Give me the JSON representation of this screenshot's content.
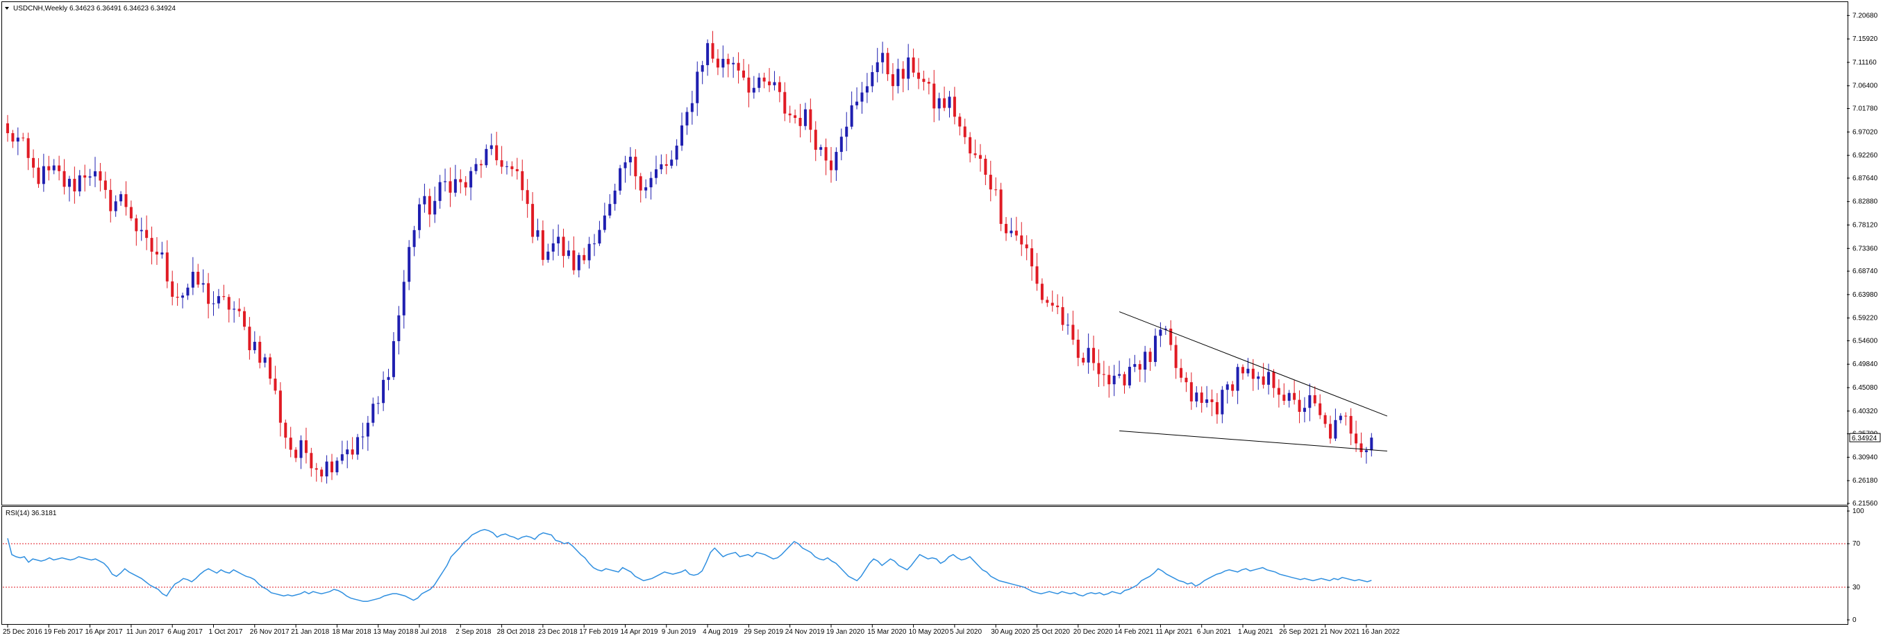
{
  "header": {
    "symbol": "USDCNH,Weekly",
    "ohlc": "6.34623 6.36491 6.34623 6.34924"
  },
  "rsi_label": "RSI(14) 36.3181",
  "current_price_label": "6.34924",
  "colors": {
    "bull": "#1f1fb0",
    "bear": "#e01b24",
    "rsi": "#2f8fe0",
    "rsi_level": "#e01b24",
    "trendline": "#000000",
    "axis": "#000000"
  },
  "chart_data": [
    {
      "type": "candlestick",
      "symbol": "USDCNH",
      "timeframe": "Weekly",
      "ylim": [
        6.2156,
        7.2242
      ],
      "y_ticks": [
        "7.20680",
        "7.15920",
        "7.11160",
        "7.06400",
        "7.01780",
        "6.97020",
        "6.92260",
        "6.87640",
        "6.82880",
        "6.78120",
        "6.73360",
        "6.68740",
        "6.63980",
        "6.59220",
        "6.54600",
        "6.49840",
        "6.45080",
        "6.40320",
        "6.35700",
        "6.30940",
        "6.26180",
        "6.21560"
      ],
      "x_ticks": [
        "25 Dec 2016",
        "19 Feb 2017",
        "16 Apr 2017",
        "11 Jun 2017",
        "6 Aug 2017",
        "1 Oct 2017",
        "26 Nov 2017",
        "21 Jan 2018",
        "18 Mar 2018",
        "13 May 2018",
        "8 Jul 2018",
        "2 Sep 2018",
        "28 Oct 2018",
        "23 Dec 2018",
        "17 Feb 2019",
        "14 Apr 2019",
        "9 Jun 2019",
        "4 Aug 2019",
        "29 Sep 2019",
        "24 Nov 2019",
        "19 Jan 2020",
        "15 Mar 2020",
        "10 May 2020",
        "5 Jul 2020",
        "30 Aug 2020",
        "25 Oct 2020",
        "20 Dec 2020",
        "14 Feb 2021",
        "11 Apr 2021",
        "6 Jun 2021",
        "1 Aug 2021",
        "26 Sep 2021",
        "21 Nov 2021",
        "16 Jan 2022"
      ],
      "path": [
        [
          "25 Dec 2016",
          6.96
        ],
        [
          "19 Feb 2017",
          6.87
        ],
        [
          "16 Apr 2017",
          6.88
        ],
        [
          "11 Jun 2017",
          6.8
        ],
        [
          "6 Aug 2017",
          6.66
        ],
        [
          "1 Oct 2017",
          6.64
        ],
        [
          "26 Nov 2017",
          6.55
        ],
        [
          "21 Jan 2018",
          6.31
        ],
        [
          "18 Mar 2018",
          6.3
        ],
        [
          "13 May 2018",
          6.4
        ],
        [
          "8 Jul 2018",
          6.82
        ],
        [
          "2 Sep 2018",
          6.87
        ],
        [
          "28 Oct 2018",
          6.93
        ],
        [
          "23 Dec 2018",
          6.74
        ],
        [
          "17 Feb 2019",
          6.71
        ],
        [
          "14 Apr 2019",
          6.89
        ],
        [
          "9 Jun 2019",
          6.88
        ],
        [
          "4 Aug 2019",
          7.14
        ],
        [
          "29 Sep 2019",
          7.08
        ],
        [
          "24 Nov 2019",
          7.02
        ],
        [
          "19 Jan 2020",
          6.92
        ],
        [
          "15 Mar 2020",
          7.1
        ],
        [
          "10 May 2020",
          7.09
        ],
        [
          "5 Jul 2020",
          7.0
        ],
        [
          "30 Aug 2020",
          6.84
        ],
        [
          "25 Oct 2020",
          6.67
        ],
        [
          "20 Dec 2020",
          6.52
        ],
        [
          "14 Feb 2021",
          6.46
        ],
        [
          "11 Apr 2021",
          6.55
        ],
        [
          "6 Jun 2021",
          6.4
        ],
        [
          "1 Aug 2021",
          6.48
        ],
        [
          "26 Sep 2021",
          6.44
        ],
        [
          "21 Nov 2021",
          6.38
        ],
        [
          "16 Jan 2022",
          6.35
        ]
      ],
      "last_close": 6.34924,
      "trendlines": [
        {
          "name": "upper",
          "from": [
            "14 Feb 2021",
            6.605
          ],
          "to": [
            "16 Jan 2022",
            6.393
          ]
        },
        {
          "name": "lower",
          "from": [
            "14 Feb 2021",
            6.363
          ],
          "to": [
            "16 Jan 2022",
            6.322
          ]
        }
      ]
    },
    {
      "type": "line",
      "name": "RSI(14)",
      "ylim": [
        0,
        100
      ],
      "y_ticks": [
        "100",
        "70",
        "30",
        "0"
      ],
      "levels": [
        70,
        30
      ],
      "last_value": 36.3181,
      "values": [
        75,
        60,
        58,
        57,
        58,
        53,
        56,
        55,
        54,
        55,
        57,
        55,
        56,
        57,
        56,
        55,
        56,
        58,
        57,
        56,
        55,
        56,
        54,
        52,
        48,
        42,
        40,
        43,
        47,
        44,
        42,
        40,
        38,
        35,
        32,
        30,
        28,
        24,
        22,
        28,
        33,
        35,
        38,
        37,
        35,
        38,
        42,
        45,
        47,
        45,
        43,
        46,
        44,
        43,
        46,
        44,
        42,
        40,
        39,
        37,
        33,
        30,
        28,
        25,
        24,
        23,
        22,
        23,
        22,
        23,
        24,
        26,
        24,
        26,
        25,
        24,
        25,
        26,
        28,
        27,
        25,
        22,
        20,
        19,
        18,
        17,
        17,
        18,
        19,
        20,
        22,
        23,
        24,
        24,
        23,
        22,
        20,
        18,
        20,
        24,
        26,
        28,
        32,
        38,
        44,
        50,
        58,
        62,
        66,
        71,
        74,
        78,
        80,
        82,
        83,
        82,
        80,
        76,
        78,
        79,
        77,
        76,
        74,
        76,
        77,
        76,
        74,
        78,
        80,
        79,
        78,
        73,
        72,
        70,
        71,
        68,
        64,
        60,
        57,
        52,
        48,
        46,
        45,
        47,
        46,
        45,
        44,
        48,
        46,
        44,
        40,
        38,
        36,
        37,
        38,
        40,
        42,
        44,
        43,
        42,
        43,
        44,
        46,
        42,
        41,
        42,
        45,
        53,
        62,
        66,
        62,
        58,
        60,
        61,
        62,
        58,
        59,
        60,
        58,
        62,
        61,
        60,
        58,
        56,
        57,
        60,
        64,
        68,
        72,
        70,
        66,
        64,
        62,
        58,
        56,
        55,
        57,
        54,
        52,
        48,
        44,
        40,
        38,
        36,
        40,
        46,
        52,
        56,
        54,
        50,
        53,
        56,
        54,
        50,
        48,
        46,
        50,
        55,
        60,
        58,
        56,
        57,
        56,
        52,
        54,
        58,
        60,
        57,
        55,
        56,
        58,
        54,
        50,
        46,
        44,
        40,
        38,
        36,
        35,
        34,
        33,
        32,
        31,
        30,
        28,
        26,
        25,
        24,
        25,
        26,
        25,
        24,
        26,
        25,
        24,
        25,
        23,
        22,
        24,
        25,
        24,
        25,
        23,
        24,
        26,
        25,
        24,
        27,
        28,
        30,
        32,
        36,
        38,
        40,
        43,
        47,
        45,
        42,
        40,
        38,
        36,
        35,
        33,
        34,
        31,
        33,
        36,
        38,
        40,
        42,
        43,
        45,
        46,
        45,
        44,
        46,
        47,
        45,
        46,
        47,
        48,
        46,
        45,
        44,
        42,
        41,
        40,
        39,
        38,
        37,
        38,
        37,
        36,
        37,
        38,
        37,
        36,
        38,
        37,
        39,
        38,
        37,
        36,
        37,
        36,
        35,
        36.3
      ]
    }
  ]
}
